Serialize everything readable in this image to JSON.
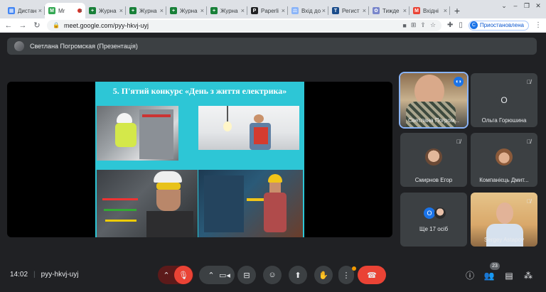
{
  "browser": {
    "tabs": [
      {
        "label": "Дистан",
        "fav": "#4285f4",
        "glyph": "▦"
      },
      {
        "label": "Mr",
        "fav": "#34a853",
        "glyph": "M",
        "active": true
      },
      {
        "label": "Журна",
        "fav": "#188038",
        "glyph": "+"
      },
      {
        "label": "Журна",
        "fav": "#188038",
        "glyph": "+"
      },
      {
        "label": "Журна",
        "fav": "#188038",
        "glyph": "+"
      },
      {
        "label": "Журна",
        "fav": "#188038",
        "glyph": "+"
      },
      {
        "label": "Paperli",
        "fav": "#202124",
        "glyph": "P"
      },
      {
        "label": "Вхід до",
        "fav": "#8ab4f8",
        "glyph": "⚖"
      },
      {
        "label": "Регист",
        "fav": "#1a4c8b",
        "glyph": "T"
      },
      {
        "label": "Тижде",
        "fav": "#7986cb",
        "glyph": "✿"
      },
      {
        "label": "Вхідні",
        "fav": "#ea4335",
        "glyph": "M"
      }
    ],
    "url": "meet.google.com/pyy-hkvj-uyj",
    "profile_status": "Приостановлена",
    "profile_initial": "C"
  },
  "meet": {
    "presenter_label": "Светлана Погромская (Презентація)",
    "slide_title": "5. П'ятий конкурс «День з життя електрика»",
    "tiles": [
      {
        "name": "Светлана Погром...",
        "kind": "video"
      },
      {
        "name": "Ольга Горюшина",
        "initial": "О",
        "kind": "avatar"
      },
      {
        "name": "Смирнов Егор",
        "kind": "photo"
      },
      {
        "name": "Компанієць Дмит...",
        "kind": "photo"
      },
      {
        "name": "Ще 17 осіб",
        "initial": "О",
        "kind": "group"
      },
      {
        "name": "Sergey Astapov",
        "kind": "video"
      }
    ],
    "time": "14:02",
    "meeting_code": "pyy-hkvj-uyj",
    "participants_count": "23"
  }
}
